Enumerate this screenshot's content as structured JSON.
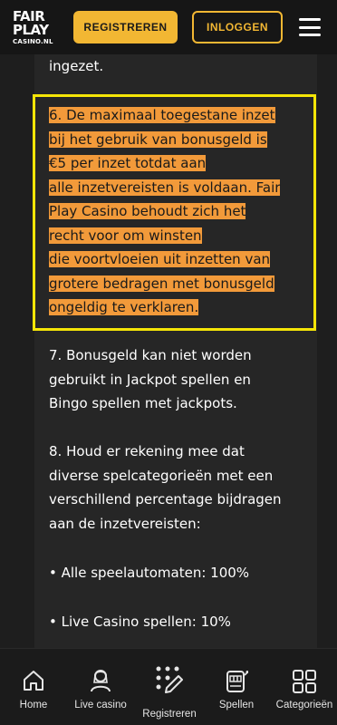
{
  "header": {
    "logo_line1": "FAIR",
    "logo_line2": "PLAY",
    "logo_line3": "CASINO.NL",
    "register_label": "REGISTREREN",
    "login_label": "INLOGGEN"
  },
  "content": {
    "intro_tail": "ingezet.",
    "highlight_lines": [
      "6. De maximaal toegestane inzet",
      "bij het gebruik van bonusgeld is",
      "€5 per inzet totdat aan",
      "alle inzetvereisten is voldaan. Fair",
      "Play Casino behoudt zich het",
      "recht voor om winsten",
      "die voortvloeien uit inzetten van",
      "grotere bedragen met bonusgeld",
      "ongeldig te verklaren."
    ],
    "p7_lines": [
      "7. Bonusgeld kan niet worden",
      "gebruikt in Jackpot spellen en",
      "Bingo spellen met jackpots."
    ],
    "p8_lines": [
      "8. Houd er rekening mee dat",
      "diverse spelcategorieën met een",
      "verschillend percentage bijdragen",
      "aan de inzetvereisten:"
    ],
    "bullet1": "• Alle speelautomaten: 100%",
    "bullet2": "• Live Casino spellen: 10%"
  },
  "nav": {
    "home": "Home",
    "live": "Live casino",
    "register": "Registreren",
    "games": "Spellen",
    "categories": "Categorieën"
  },
  "colors": {
    "accent": "#f2b733",
    "highlight": "#f29a3a",
    "outline": "#f5e507"
  }
}
